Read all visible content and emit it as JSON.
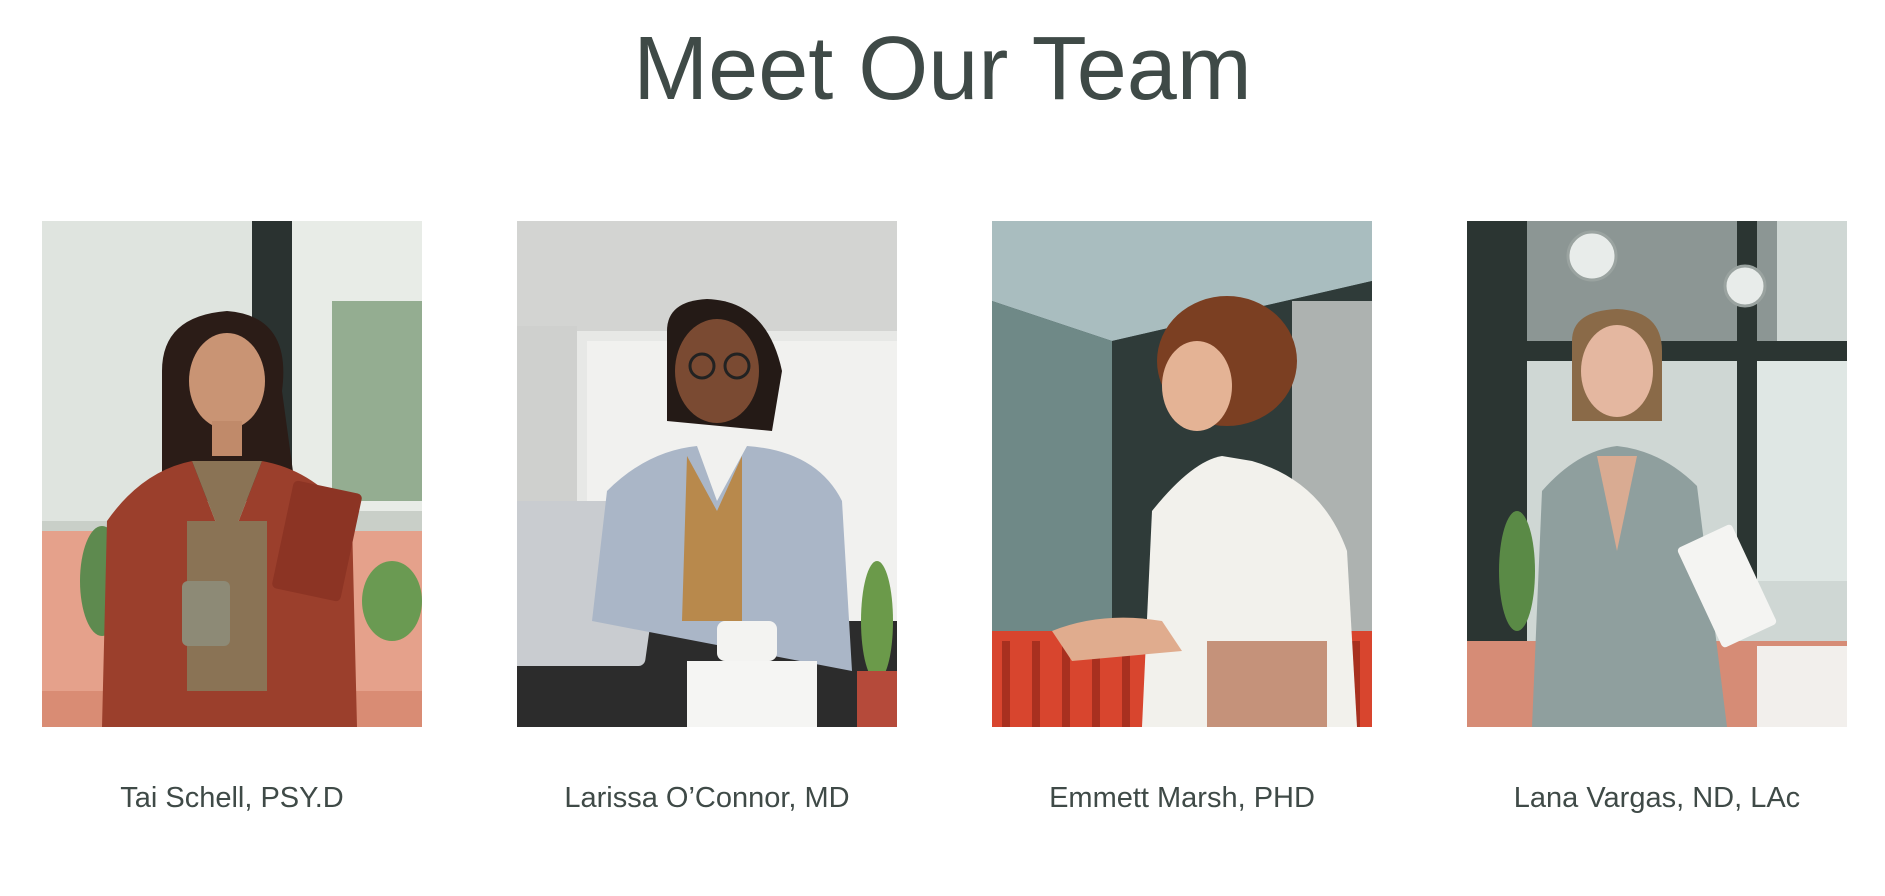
{
  "header": {
    "title": "Meet Our Team"
  },
  "team": [
    {
      "name": "Tai Schell, PSY.D",
      "photo_icon": "portrait-photo"
    },
    {
      "name": "Larissa O’Connor, MD",
      "photo_icon": "portrait-photo"
    },
    {
      "name": "Emmett Marsh, PHD",
      "photo_icon": "portrait-photo"
    },
    {
      "name": "Lana Vargas, ND, LAc",
      "photo_icon": "portrait-photo"
    }
  ],
  "colors": {
    "text": "#3f4a47",
    "background": "#ffffff"
  }
}
